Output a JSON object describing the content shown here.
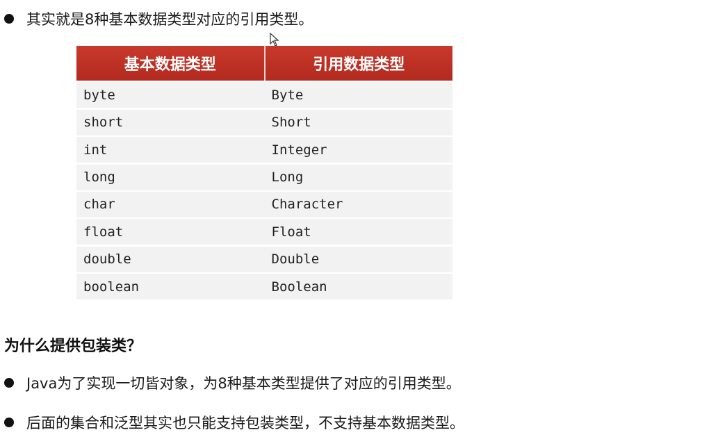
{
  "intro_text": "其实就是8种基本数据类型对应的引用类型。",
  "table": {
    "headers": [
      "基本数据类型",
      "引用数据类型"
    ],
    "rows": [
      [
        "byte",
        "Byte"
      ],
      [
        "short",
        "Short"
      ],
      [
        "int",
        "Integer"
      ],
      [
        "long",
        "Long"
      ],
      [
        "char",
        "Character"
      ],
      [
        "float",
        "Float"
      ],
      [
        "double",
        "Double"
      ],
      [
        "boolean",
        "Boolean"
      ]
    ],
    "header_color": "#c0392b"
  },
  "section_heading": "为什么提供包装类？",
  "reasons": [
    "Java为了实现一切皆对象，为8种基本类型提供了对应的引用类型。",
    "后面的集合和泛型其实也只能支持包装类型，不支持基本数据类型。"
  ],
  "icons": {
    "bullet": "bullet-dot-icon",
    "cursor": "mouse-cursor-icon"
  }
}
